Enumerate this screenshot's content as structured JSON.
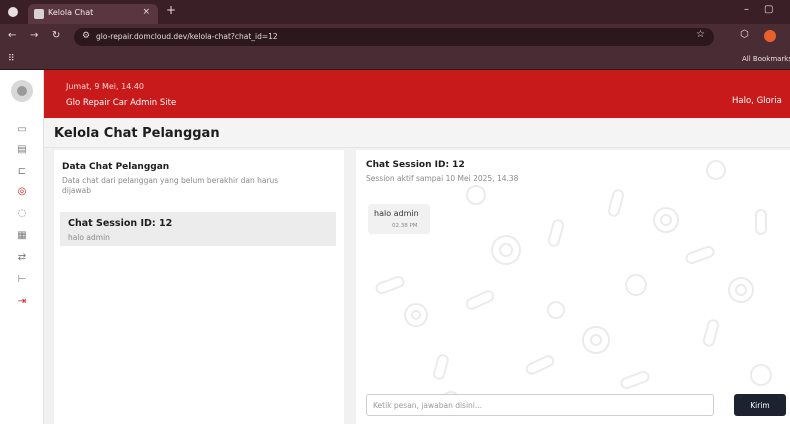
{
  "browser": {
    "tab_title": "Kelola Chat",
    "tab_close": "×",
    "new_tab": "+",
    "url": "glo-repair.domcloud.dev/kelola-chat?chat_id=12",
    "bookmarks_label": "All Bookmarks",
    "minimize": "–",
    "maximize": "▢",
    "back": "←",
    "forward": "→",
    "reload": "↻"
  },
  "header": {
    "date": "Jumat, 9 Mei, 14.40",
    "site_name": "Glo Repair Car Admin Site",
    "greeting": "Halo, Gloria"
  },
  "page": {
    "title": "Kelola Chat Pelanggan"
  },
  "left_panel": {
    "title": "Data Chat Pelanggan",
    "description": "Data chat dari pelanggan yang belum berakhir dan harus dijawab",
    "sessions": [
      {
        "title": "Chat Session ID: 12",
        "last_message": "halo admin"
      }
    ]
  },
  "chat": {
    "title": "Chat Session ID: 12",
    "subtitle": "Session aktif sampai 10 Mei 2025, 14.38",
    "messages": [
      {
        "text": "halo admin",
        "time": "02.38 PM"
      }
    ],
    "input_placeholder": "Ketik pesan, jawaban disini...",
    "send_label": "Kirim"
  },
  "sidebar": {
    "icons": [
      "logo-icon",
      "monitor-icon",
      "receipt-icon",
      "car-icon",
      "chat-icon",
      "location-icon",
      "inventory-icon",
      "transfer-icon",
      "wrench-icon",
      "logout-icon"
    ]
  },
  "colors": {
    "brand_red": "#c81a1a",
    "dark_button": "#1d2230"
  }
}
